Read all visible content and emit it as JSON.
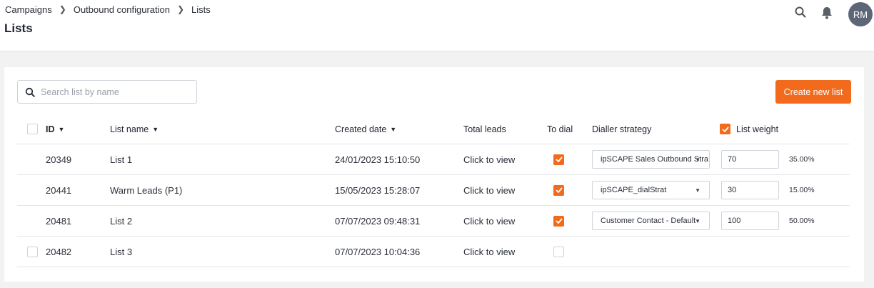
{
  "breadcrumb": [
    "Campaigns",
    "Outbound configuration",
    "Lists"
  ],
  "page_title": "Lists",
  "user": {
    "initials": "RM"
  },
  "search": {
    "placeholder": "Search list by name",
    "value": ""
  },
  "create_button": "Create new list",
  "columns": {
    "id": "ID",
    "name": "List name",
    "created": "Created date",
    "total_leads": "Total leads",
    "to_dial": "To dial",
    "strategy": "Dialler strategy",
    "weight": "List weight"
  },
  "list_weight_header_checked": true,
  "rows": [
    {
      "id": "20349",
      "name": "List 1",
      "created": "24/01/2023 15:10:50",
      "total_leads": "Click to view",
      "to_dial": true,
      "strategy": "ipSCAPE Sales Outbound Stra",
      "weight": "70",
      "percent": "35.00%"
    },
    {
      "id": "20441",
      "name": "Warm Leads (P1)",
      "created": "15/05/2023 15:28:07",
      "total_leads": "Click to view",
      "to_dial": true,
      "strategy": "ipSCAPE_dialStrat",
      "weight": "30",
      "percent": "15.00%"
    },
    {
      "id": "20481",
      "name": "List 2",
      "created": "07/07/2023 09:48:31",
      "total_leads": "Click to view",
      "to_dial": true,
      "strategy": "Customer Contact - Default",
      "weight": "100",
      "percent": "50.00%"
    },
    {
      "id": "20482",
      "name": "List 3",
      "created": "07/07/2023 10:04:36",
      "total_leads": "Click to view",
      "to_dial": false,
      "strategy": "",
      "weight": "",
      "percent": ""
    }
  ],
  "colors": {
    "accent": "#f26a1b",
    "avatar": "#5d6677"
  },
  "icons": [
    "search-icon",
    "bell-icon",
    "chevron-right-icon",
    "sort-down-icon",
    "check-icon",
    "caret-down-icon"
  ]
}
